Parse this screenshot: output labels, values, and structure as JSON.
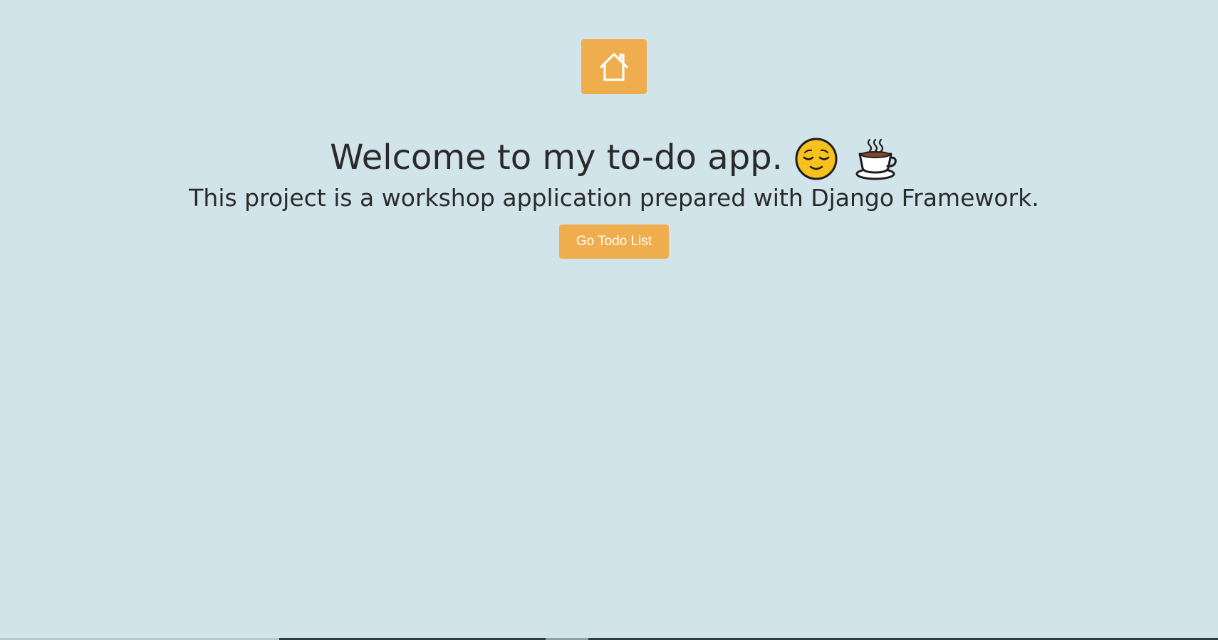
{
  "home": {
    "icon": "house-icon",
    "color": "#f0ad4e"
  },
  "hero": {
    "title": "Welcome to my to-do app.",
    "emojis": [
      "relieved-face-icon",
      "hot-beverage-icon"
    ],
    "subtitle": "This project is a workshop application prepared with Django Framework."
  },
  "cta": {
    "label": "Go Todo List",
    "color": "#f0ad4e"
  },
  "theme": {
    "background": "#d1e4ea",
    "text": "#2a2a2a",
    "accent": "#f0ad4e"
  }
}
